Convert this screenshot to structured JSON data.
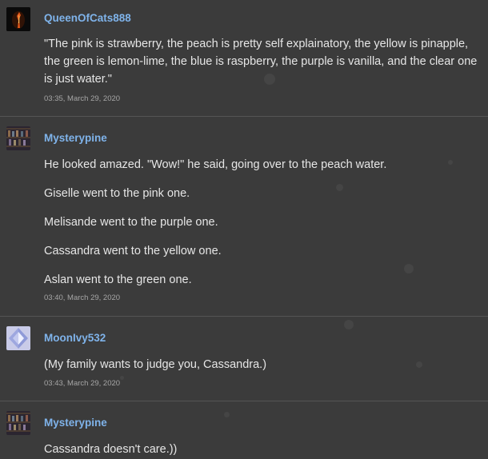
{
  "posts": [
    {
      "user": "QueenOfCats888",
      "avatar": "fire-avatar",
      "paragraphs": [
        "\"The pink is strawberry, the peach is pretty self explainatory, the yellow is pinapple, the green is lemon-lime, the blue is raspberry, the purple is vanilla, and the clear one is just water.\""
      ],
      "time": "03:35, March 29, 2020"
    },
    {
      "user": "Mysterypine",
      "avatar": "shelves-avatar",
      "paragraphs": [
        "He looked amazed. \"Wow!\" he said, going over to the peach water.",
        "Giselle went to the pink one.",
        "Melisande went to the purple one.",
        "Cassandra went to the yellow one.",
        "Aslan went to the green one."
      ],
      "time": "03:40, March 29, 2020"
    },
    {
      "user": "MoonIvy532",
      "avatar": "crystal-avatar",
      "paragraphs": [
        "(My family wants to judge you, Cassandra.)"
      ],
      "time": "03:43, March 29, 2020"
    },
    {
      "user": "Mysterypine",
      "avatar": "shelves-avatar",
      "paragraphs": [
        "Cassandra doesn't care.))"
      ],
      "time": ""
    }
  ]
}
